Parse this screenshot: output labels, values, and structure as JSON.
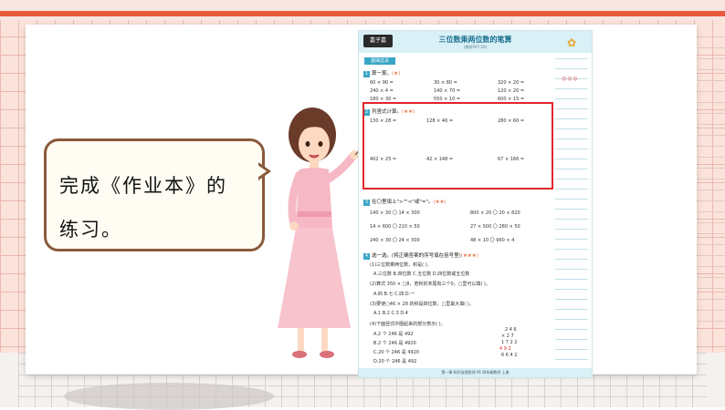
{
  "bubble": {
    "line1": "完成《作业本》的",
    "line2": "练习。"
  },
  "workbook": {
    "logo": "嘉子嘉",
    "title": "三位数乘两位数的笔算",
    "subtitle": "(教材P47-50)",
    "rating": "☺☺☺",
    "tag": "基础过关",
    "section1": {
      "num": "1",
      "label": "算一算。",
      "stars": "(★)",
      "rows": [
        [
          "60 × 90 =",
          "30 × 80 =",
          "320 × 20 ="
        ],
        [
          "240 × 4 =",
          "140 × 70 =",
          "120 × 20 ="
        ],
        [
          "180 × 30 =",
          "550 × 10 =",
          "600 × 15 ="
        ]
      ]
    },
    "section2": {
      "num": "2",
      "label": "列竖式计算。",
      "stars": "(★★)",
      "rows": [
        [
          "130 × 28 =",
          "128 × 46 =",
          "280 × 60 ="
        ],
        [
          "402 × 25 =",
          "42 × 148 =",
          "67 × 166 ="
        ]
      ]
    },
    "section3": {
      "num": "3",
      "label": "在〇里填上\">\"\"<\"或\"=\"。",
      "stars": "(★★)",
      "rows": [
        [
          "140 × 30 〇 14 × 300",
          "800 × 20 〇 20 × 820"
        ],
        [
          "14 × 600 〇 210 × 50",
          "27 × 500 〇 280 × 50"
        ],
        [
          "240 × 30 〇 24 × 300",
          "48 × 10 〇 960 × 4"
        ]
      ]
    },
    "section4": {
      "num": "4",
      "label": "选一选。(将正确答案的序号填在括号里)",
      "stars": "(★★★)",
      "lines": [
        "(1)三位数乘两位数，积是(     )。",
        "A.三位数       B.四位数       C.五位数       D.四位数或五位数",
        "(2)算式 350 × □8，若积的末尾有三个0，□里可以填(     )。",
        "A.四        B.七        C.四        D.一",
        "(3)要使□46 × 28 的积是四位数，□里最大填(     )。",
        "A.1         B.2         C.3         D.4",
        "(4)下面竖式中圈起来的部分表示(     )。",
        "A.2 个 246 是 492",
        "B.2 个 246 是 4920",
        "C.20 个 246 是 4920",
        "D.20 个 246 是 492"
      ],
      "vertical": [
        "2 4 6",
        "×   2 7",
        "1 7 2 2",
        "4 9 2",
        "6 6 4 2"
      ]
    },
    "footer": "第一章  知识自我检测  91  四年级数学·上册"
  }
}
